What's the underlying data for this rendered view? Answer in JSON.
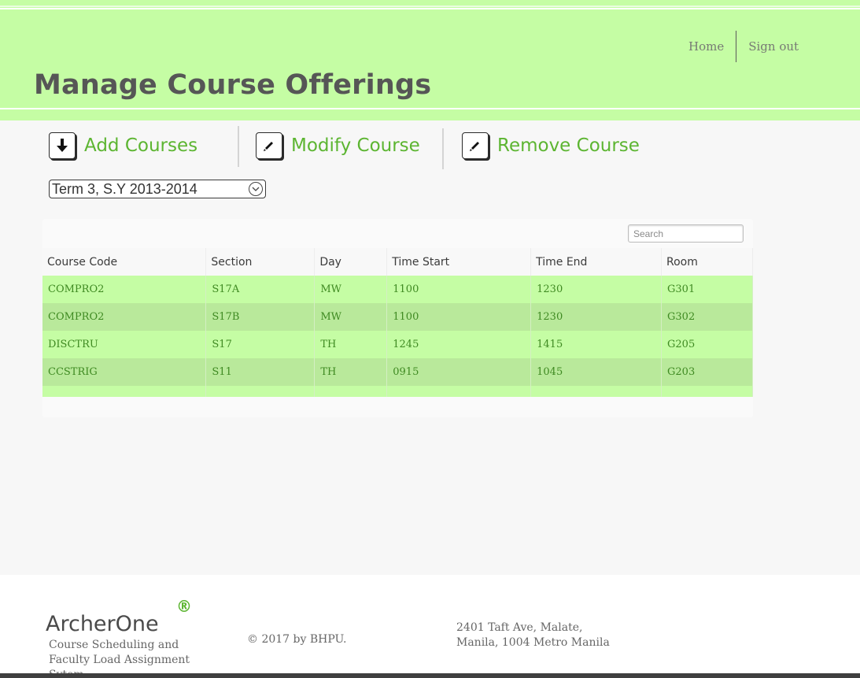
{
  "header": {
    "nav": [
      {
        "label": "Home"
      },
      {
        "label": "Sign out"
      }
    ],
    "title": "Manage Course Offerings"
  },
  "actions": [
    {
      "label": "Add Courses",
      "icon": "download-arrow-icon"
    },
    {
      "label": "Modify Course",
      "icon": "pencil-icon"
    },
    {
      "label": "Remove Course",
      "icon": "pencil-icon"
    }
  ],
  "term_select": {
    "value": "Term 3, S.Y 2013-2014"
  },
  "table": {
    "search_placeholder": "Search",
    "columns": [
      "Course Code",
      "Section",
      "Day",
      "Time Start",
      "Time End",
      "Room"
    ],
    "rows": [
      [
        "COMPRO2",
        "S17A",
        "MW",
        "1100",
        "1230",
        "G301"
      ],
      [
        "COMPRO2",
        "S17B",
        "MW",
        "1100",
        "1230",
        "G302"
      ],
      [
        "DISCTRU",
        "S17",
        "TH",
        "1245",
        "1415",
        "G205"
      ],
      [
        "CCSTRIG",
        "S11",
        "TH",
        "0915",
        "1045",
        "G203"
      ]
    ]
  },
  "footer": {
    "brand": "ArcherOne",
    "registered_mark": "®",
    "tagline": "Course Scheduling and Faculty Load Assignment Sytem",
    "copyright": "© 2017 by BHPU.",
    "address_line1": "2401 Taft Ave, Malate,",
    "address_line2": "Manila, 1004 Metro Manila"
  },
  "colors": {
    "header_bg": "#c5fda4",
    "accent_green": "#5cb531",
    "row_alt": "#b9e99b"
  }
}
